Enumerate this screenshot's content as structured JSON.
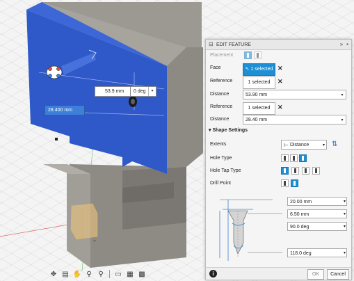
{
  "colors": {
    "face_blue": "#2f58c8",
    "accent": "#1d8fd4",
    "body_gray": "#8e8b85"
  },
  "viewport": {
    "tooltip_distance": "53.9 mm",
    "tooltip_angle": "0 deg",
    "offset_value": "28.400 mm"
  },
  "navbar": {
    "icons": [
      "orbit-icon",
      "pan-icon",
      "zoom-icon",
      "zoom-fit-icon",
      "display-settings-icon",
      "visual-style-icon",
      "grid-icon"
    ]
  },
  "panel": {
    "title": "EDIT FEATURE",
    "placement_label": "Placement",
    "face_label": "Face",
    "face_value": "1 selected",
    "reference1_label": "Reference",
    "reference1_value": "1 selected",
    "distance1_label": "Distance",
    "distance1_value": "53.90 mm",
    "reference2_label": "Reference",
    "reference2_value": "1 selected",
    "distance2_label": "Distance",
    "distance2_value": "28.40 mm",
    "shape_settings_label": "Shape Settings",
    "extents_label": "Extents",
    "extents_value": "Distance",
    "hole_type_label": "Hole Type",
    "hole_tap_type_label": "Hole Tap Type",
    "drill_point_label": "Drill Point",
    "dim_1": "20.00 mm",
    "dim_2": "6.50 mm",
    "dim_3": "90.0 deg",
    "dim_4": "118.0 deg",
    "ok_label": "OK",
    "cancel_label": "Cancel"
  }
}
